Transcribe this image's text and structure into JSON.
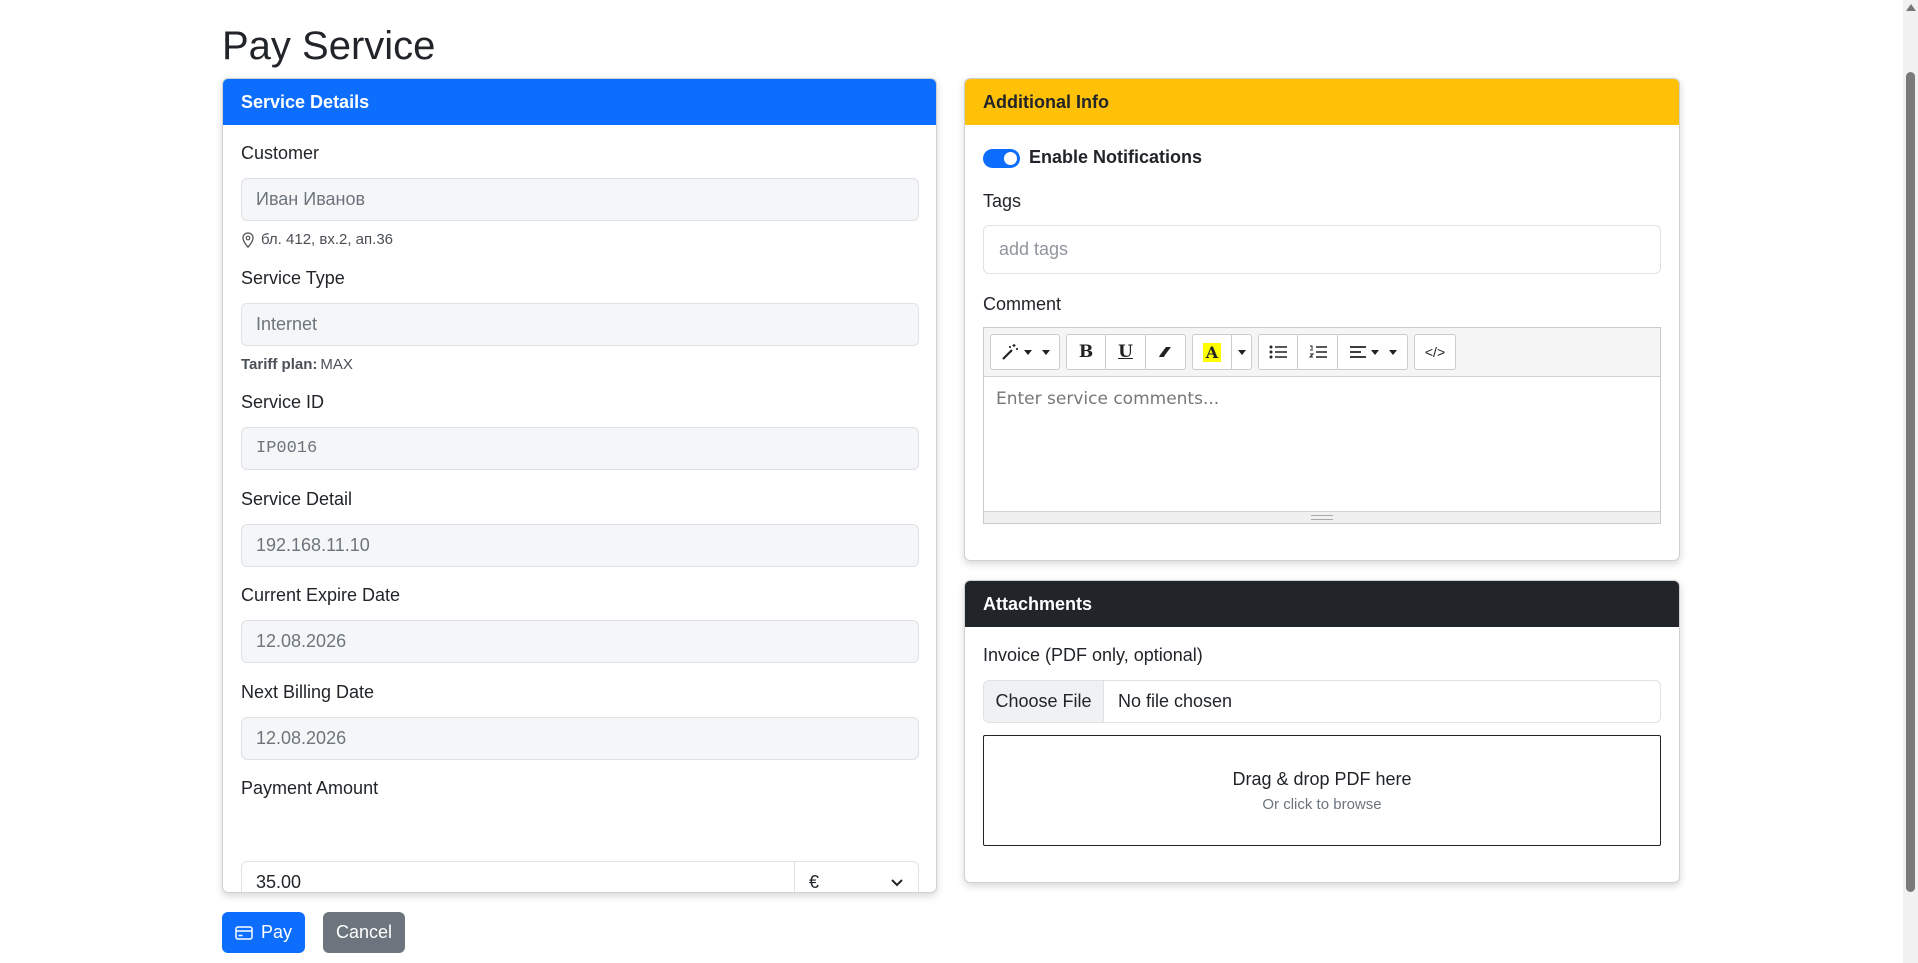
{
  "page": {
    "title": "Pay Service"
  },
  "service_details": {
    "header": "Service Details",
    "customer": {
      "label": "Customer",
      "value": "Иван Иванов",
      "address": "бл. 412, вх.2, ап.36"
    },
    "service_type": {
      "label": "Service Type",
      "value": "Internet",
      "tariff_label": "Tariff plan:",
      "tariff_value": "MAX"
    },
    "service_id": {
      "label": "Service ID",
      "value": "IP0016"
    },
    "service_detail": {
      "label": "Service Detail",
      "value": "192.168.11.10"
    },
    "current_expire": {
      "label": "Current Expire Date",
      "value": "12.08.2026"
    },
    "next_billing": {
      "label": "Next Billing Date",
      "value": "12.08.2026"
    },
    "payment": {
      "label": "Payment Amount",
      "value": "35.00",
      "currency": "€"
    }
  },
  "additional_info": {
    "header": "Additional Info",
    "notifications": {
      "label": "Enable Notifications",
      "enabled": true
    },
    "tags": {
      "label": "Tags",
      "placeholder": "add tags"
    },
    "comment": {
      "label": "Comment",
      "placeholder": "Enter service comments..."
    },
    "toolbar": {
      "bold": "B",
      "underline": "U",
      "highlight": "A",
      "code": "</>"
    }
  },
  "attachments": {
    "header": "Attachments",
    "invoice_label": "Invoice (PDF only, optional)",
    "choose_file": "Choose File",
    "file_status": "No file chosen",
    "drop_title": "Drag & drop PDF here",
    "drop_sub": "Or click to browse"
  },
  "actions": {
    "pay": "Pay",
    "cancel": "Cancel"
  },
  "colors": {
    "primary": "#0d6efd",
    "warning": "#ffc107",
    "dark": "#212529",
    "secondary": "#6c757d"
  }
}
